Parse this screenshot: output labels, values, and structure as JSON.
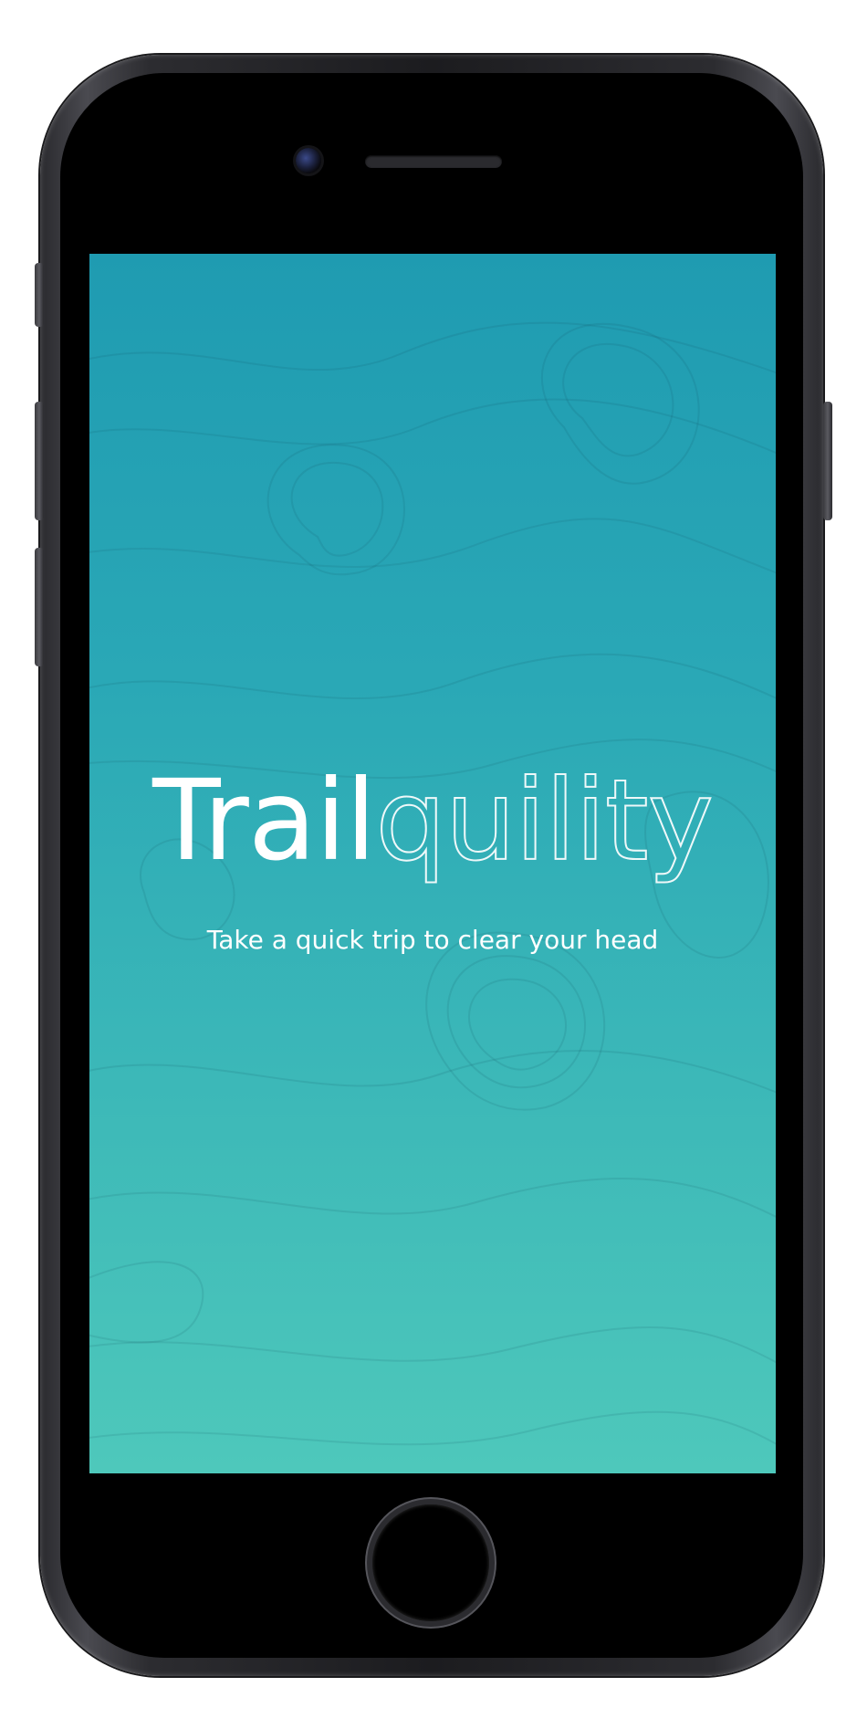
{
  "app": {
    "title_bold": "Trail",
    "title_light": "quility",
    "tagline": "Take a quick trip to clear your head"
  },
  "device": {
    "icons": {
      "camera": "front-camera-icon",
      "speaker": "earpiece-speaker-icon",
      "home": "home-button-icon"
    }
  },
  "colors": {
    "gradient_top": "#1f9bb1",
    "gradient_bottom": "#4ec8bb",
    "text": "#ffffff",
    "frame": "#2c2c30"
  }
}
